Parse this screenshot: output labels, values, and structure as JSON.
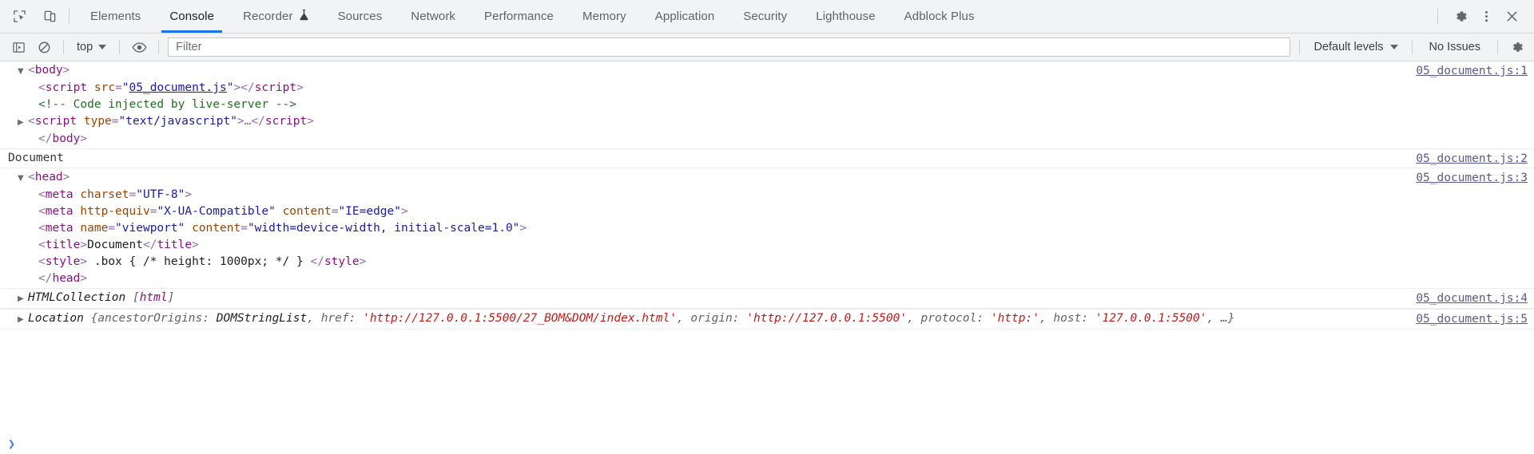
{
  "window": {
    "title": "Chrome DevTools - Console"
  },
  "toolbar_left_icons": [
    {
      "name": "inspect-element-icon",
      "label": "Inspect element"
    },
    {
      "name": "device-toolbar-icon",
      "label": "Toggle device toolbar"
    }
  ],
  "tabs": [
    {
      "label": "Elements",
      "active": false,
      "icon": ""
    },
    {
      "label": "Console",
      "active": true,
      "icon": ""
    },
    {
      "label": "Recorder",
      "active": false,
      "icon": "flask-icon"
    },
    {
      "label": "Sources",
      "active": false,
      "icon": ""
    },
    {
      "label": "Network",
      "active": false,
      "icon": ""
    },
    {
      "label": "Performance",
      "active": false,
      "icon": ""
    },
    {
      "label": "Memory",
      "active": false,
      "icon": ""
    },
    {
      "label": "Application",
      "active": false,
      "icon": ""
    },
    {
      "label": "Security",
      "active": false,
      "icon": ""
    },
    {
      "label": "Lighthouse",
      "active": false,
      "icon": ""
    },
    {
      "label": "Adblock Plus",
      "active": false,
      "icon": ""
    }
  ],
  "tabbar_right_icons": [
    {
      "name": "settings-gear-icon",
      "label": "Settings"
    },
    {
      "name": "more-options-icon",
      "label": "Customize and control DevTools"
    },
    {
      "name": "close-devtools-icon",
      "label": "Close DevTools"
    }
  ],
  "console_toolbar": {
    "sidebar_toggle": "Show console sidebar",
    "clear_console": "Clear console",
    "context_value": "top",
    "live_expression": "Create live expression",
    "filter": {
      "placeholder": "Filter",
      "value": ""
    },
    "levels_value": "Default levels",
    "issues_label": "No Issues",
    "settings_label": "Console settings"
  },
  "accent": {
    "active_tab_underline": "#1a73e8",
    "prompt_chevron": "#3b78e7",
    "tag": "#881280",
    "attr_name": "#994500",
    "attr_value": "#1a1aa6",
    "comment": "#236e25",
    "string": "#c41a16",
    "source_link": "#5a5a8a"
  },
  "messages": [
    {
      "id": "msg-body-node",
      "source_link": "05_document.js:1",
      "lines": [
        {
          "indent": 0,
          "expander": "expanded",
          "segments": [
            {
              "t": "<",
              "c": "tagpunct"
            },
            {
              "t": "body",
              "c": "tag"
            },
            {
              "t": ">",
              "c": "tagpunct"
            }
          ]
        },
        {
          "indent": 1,
          "expander": "none",
          "segments": [
            {
              "t": "<",
              "c": "tagpunct"
            },
            {
              "t": "script",
              "c": "tag"
            },
            {
              "t": " ",
              "c": "plain"
            },
            {
              "t": "src",
              "c": "attr"
            },
            {
              "t": "=",
              "c": "tagpunct"
            },
            {
              "t": "\"",
              "c": "val"
            },
            {
              "t": "05_document.js",
              "c": "link"
            },
            {
              "t": "\"",
              "c": "val"
            },
            {
              "t": ">",
              "c": "tagpunct"
            },
            {
              "t": "</",
              "c": "tagpunct"
            },
            {
              "t": "script",
              "c": "tag"
            },
            {
              "t": ">",
              "c": "tagpunct"
            }
          ]
        },
        {
          "indent": 1,
          "expander": "none",
          "segments": [
            {
              "t": "<!-- Code injected by live-server -->",
              "c": "comment"
            }
          ]
        },
        {
          "indent": 0,
          "expander": "collapsed",
          "segments": [
            {
              "t": "<",
              "c": "tagpunct"
            },
            {
              "t": "script",
              "c": "tag"
            },
            {
              "t": " ",
              "c": "plain"
            },
            {
              "t": "type",
              "c": "attr"
            },
            {
              "t": "=",
              "c": "tagpunct"
            },
            {
              "t": "\"text/javascript\"",
              "c": "val"
            },
            {
              "t": ">",
              "c": "tagpunct"
            },
            {
              "t": "…",
              "c": "ellip"
            },
            {
              "t": "</",
              "c": "tagpunct"
            },
            {
              "t": "script",
              "c": "tag"
            },
            {
              "t": ">",
              "c": "tagpunct"
            }
          ]
        },
        {
          "indent": 1,
          "expander": "none",
          "segments": [
            {
              "t": "</",
              "c": "tagpunct"
            },
            {
              "t": "body",
              "c": "tag"
            },
            {
              "t": ">",
              "c": "tagpunct"
            }
          ]
        }
      ]
    },
    {
      "id": "msg-document-title",
      "source_link": "05_document.js:2",
      "bordered": true,
      "plain_text": "Document",
      "lines": []
    },
    {
      "id": "msg-head-node",
      "source_link": "05_document.js:3",
      "lines": [
        {
          "indent": 0,
          "expander": "expanded",
          "segments": [
            {
              "t": "<",
              "c": "tagpunct"
            },
            {
              "t": "head",
              "c": "tag"
            },
            {
              "t": ">",
              "c": "tagpunct"
            }
          ]
        },
        {
          "indent": 1,
          "expander": "none",
          "segments": [
            {
              "t": "<",
              "c": "tagpunct"
            },
            {
              "t": "meta",
              "c": "tag"
            },
            {
              "t": " ",
              "c": "plain"
            },
            {
              "t": "charset",
              "c": "attr"
            },
            {
              "t": "=",
              "c": "tagpunct"
            },
            {
              "t": "\"UTF-8\"",
              "c": "val"
            },
            {
              "t": ">",
              "c": "tagpunct"
            }
          ]
        },
        {
          "indent": 1,
          "expander": "none",
          "segments": [
            {
              "t": "<",
              "c": "tagpunct"
            },
            {
              "t": "meta",
              "c": "tag"
            },
            {
              "t": " ",
              "c": "plain"
            },
            {
              "t": "http-equiv",
              "c": "attr"
            },
            {
              "t": "=",
              "c": "tagpunct"
            },
            {
              "t": "\"X-UA-Compatible\"",
              "c": "val"
            },
            {
              "t": " ",
              "c": "plain"
            },
            {
              "t": "content",
              "c": "attr"
            },
            {
              "t": "=",
              "c": "tagpunct"
            },
            {
              "t": "\"IE=edge\"",
              "c": "val"
            },
            {
              "t": ">",
              "c": "tagpunct"
            }
          ]
        },
        {
          "indent": 1,
          "expander": "none",
          "segments": [
            {
              "t": "<",
              "c": "tagpunct"
            },
            {
              "t": "meta",
              "c": "tag"
            },
            {
              "t": " ",
              "c": "plain"
            },
            {
              "t": "name",
              "c": "attr"
            },
            {
              "t": "=",
              "c": "tagpunct"
            },
            {
              "t": "\"viewport\"",
              "c": "val"
            },
            {
              "t": " ",
              "c": "plain"
            },
            {
              "t": "content",
              "c": "attr"
            },
            {
              "t": "=",
              "c": "tagpunct"
            },
            {
              "t": "\"width=device-width, initial-scale=1.0\"",
              "c": "val"
            },
            {
              "t": ">",
              "c": "tagpunct"
            }
          ]
        },
        {
          "indent": 1,
          "expander": "none",
          "segments": [
            {
              "t": "<",
              "c": "tagpunct"
            },
            {
              "t": "title",
              "c": "tag"
            },
            {
              "t": ">",
              "c": "tagpunct"
            },
            {
              "t": "Document",
              "c": "txt"
            },
            {
              "t": "</",
              "c": "tagpunct"
            },
            {
              "t": "title",
              "c": "tag"
            },
            {
              "t": ">",
              "c": "tagpunct"
            }
          ]
        },
        {
          "indent": 1,
          "expander": "none",
          "segments": [
            {
              "t": "<",
              "c": "tagpunct"
            },
            {
              "t": "style",
              "c": "tag"
            },
            {
              "t": ">",
              "c": "tagpunct"
            },
            {
              "t": " .box { /* height: 1000px; */ } ",
              "c": "txt"
            },
            {
              "t": "</",
              "c": "tagpunct"
            },
            {
              "t": "style",
              "c": "tag"
            },
            {
              "t": ">",
              "c": "tagpunct"
            }
          ]
        },
        {
          "indent": 1,
          "expander": "none",
          "segments": [
            {
              "t": "</",
              "c": "tagpunct"
            },
            {
              "t": "head",
              "c": "tag"
            },
            {
              "t": ">",
              "c": "tagpunct"
            }
          ]
        }
      ]
    },
    {
      "id": "msg-htmlcollection",
      "source_link": "05_document.js:4",
      "bordered": true,
      "lines": [
        {
          "indent": 0,
          "expander": "collapsed",
          "segments": [
            {
              "t": "HTMLCollection",
              "c": "objname"
            },
            {
              "t": " ",
              "c": "plain"
            },
            {
              "t": "[",
              "c": "brack"
            },
            {
              "t": "html",
              "c": "purple"
            },
            {
              "t": "]",
              "c": "brack"
            }
          ]
        }
      ]
    },
    {
      "id": "msg-location",
      "source_link": "05_document.js:5",
      "bordered": true,
      "lines": [
        {
          "indent": 0,
          "expander": "collapsed",
          "segments": [
            {
              "t": "Location",
              "c": "objname"
            },
            {
              "t": " ",
              "c": "plain"
            },
            {
              "t": "{",
              "c": "brack"
            },
            {
              "t": "ancestorOrigins",
              "c": "prop"
            },
            {
              "t": ": ",
              "c": "brack"
            },
            {
              "t": "DOMStringList",
              "c": "objval"
            },
            {
              "t": ", ",
              "c": "brack"
            },
            {
              "t": "href",
              "c": "prop"
            },
            {
              "t": ": ",
              "c": "brack"
            },
            {
              "t": "'http://127.0.0.1:5500/27_BOM&DOM/index.html'",
              "c": "strval"
            },
            {
              "t": ", ",
              "c": "brack"
            },
            {
              "t": "origin",
              "c": "prop"
            },
            {
              "t": ": ",
              "c": "brack"
            },
            {
              "t": "'http://127.0.0.1:5500'",
              "c": "strval"
            },
            {
              "t": ", ",
              "c": "brack"
            },
            {
              "t": "protocol",
              "c": "prop"
            },
            {
              "t": ": ",
              "c": "brack"
            },
            {
              "t": "'http:'",
              "c": "strval"
            },
            {
              "t": ", ",
              "c": "brack"
            },
            {
              "t": "host",
              "c": "prop"
            },
            {
              "t": ": ",
              "c": "brack"
            },
            {
              "t": "'127.0.0.1:5500'",
              "c": "strval"
            },
            {
              "t": ", ",
              "c": "brack"
            },
            {
              "t": "…}",
              "c": "brack"
            }
          ]
        }
      ]
    }
  ],
  "prompt": {
    "chevron": "❯",
    "value": ""
  }
}
